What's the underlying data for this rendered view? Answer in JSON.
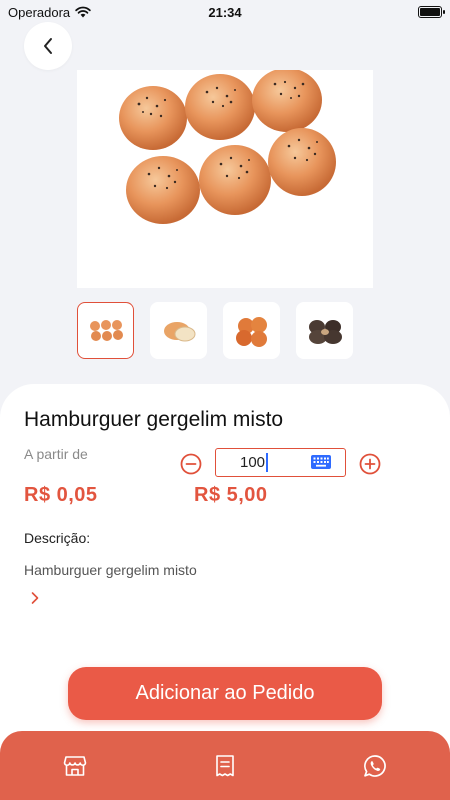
{
  "status_bar": {
    "carrier": "Operadora",
    "time": "21:34"
  },
  "product": {
    "name": "Hamburguer gergelim misto",
    "from_label": "A partir de",
    "unit_price": "R$ 0,05",
    "total_price": "R$ 5,00",
    "quantity": "100",
    "description_label": "Descrição:",
    "description": "Hamburguer gergelim misto"
  },
  "thumbnails": [
    {
      "name": "buns-grid",
      "selected": true
    },
    {
      "name": "bread-roll",
      "selected": false
    },
    {
      "name": "bun-pile",
      "selected": false
    },
    {
      "name": "dark-buns",
      "selected": false
    }
  ],
  "actions": {
    "add_to_order": "Adicionar ao Pedido"
  },
  "bottom_nav": {
    "icons": [
      "store-icon",
      "receipt-icon",
      "whatsapp-icon"
    ]
  },
  "colors": {
    "accent": "#e2553f",
    "button": "#ea5a47",
    "bottom_bar": "#e0624c",
    "background": "#f2f3f7"
  }
}
